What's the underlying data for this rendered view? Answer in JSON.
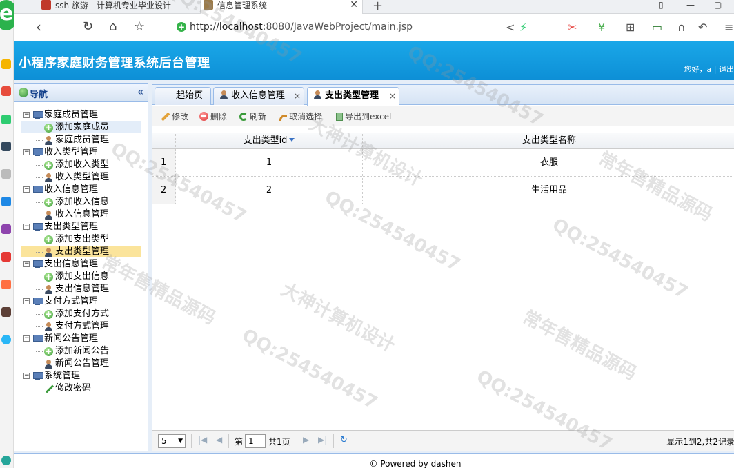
{
  "browser": {
    "tabs": [
      {
        "title": "ssh 旅游 - 计算机专业毕业设计"
      },
      {
        "title": "信息管理系统"
      }
    ],
    "url_prefix": "http://",
    "url_host": "localhost",
    "url_path": ":8080/JavaWebProject/main.jsp"
  },
  "header": {
    "title": "小程序家庭财务管理系统后台管理",
    "user_text": "您好，a | 退出"
  },
  "nav": {
    "title": "导航",
    "groups": [
      {
        "label": "家庭成员管理",
        "children": [
          {
            "label": "添加家庭成员",
            "icon": "add-icon"
          },
          {
            "label": "家庭成员管理",
            "icon": "user-icon"
          }
        ]
      },
      {
        "label": "收入类型管理",
        "children": [
          {
            "label": "添加收入类型",
            "icon": "add-icon"
          },
          {
            "label": "收入类型管理",
            "icon": "user-icon"
          }
        ]
      },
      {
        "label": "收入信息管理",
        "children": [
          {
            "label": "添加收入信息",
            "icon": "add-icon"
          },
          {
            "label": "收入信息管理",
            "icon": "user-icon"
          }
        ]
      },
      {
        "label": "支出类型管理",
        "children": [
          {
            "label": "添加支出类型",
            "icon": "add-icon"
          },
          {
            "label": "支出类型管理",
            "icon": "user-icon"
          }
        ]
      },
      {
        "label": "支出信息管理",
        "children": [
          {
            "label": "添加支出信息",
            "icon": "add-icon"
          },
          {
            "label": "支出信息管理",
            "icon": "user-icon"
          }
        ]
      },
      {
        "label": "支付方式管理",
        "children": [
          {
            "label": "添加支付方式",
            "icon": "add-icon"
          },
          {
            "label": "支付方式管理",
            "icon": "user-icon"
          }
        ]
      },
      {
        "label": "新闻公告管理",
        "children": [
          {
            "label": "添加新闻公告",
            "icon": "add-icon"
          },
          {
            "label": "新闻公告管理",
            "icon": "user-icon"
          }
        ]
      },
      {
        "label": "系统管理",
        "children": [
          {
            "label": "修改密码",
            "icon": "pencil-icon"
          }
        ]
      }
    ]
  },
  "center": {
    "tabs": [
      {
        "label": "起始页"
      },
      {
        "label": "收入信息管理",
        "close": "×"
      },
      {
        "label": "支出类型管理",
        "close": "×"
      }
    ],
    "toolbar": {
      "edit": "修改",
      "delete": "删除",
      "refresh": "刷新",
      "cancel_select": "取消选择",
      "export": "导出到excel"
    },
    "grid": {
      "columns": [
        "支出类型id",
        "支出类型名称"
      ],
      "rows": [
        {
          "rownum": "1",
          "id": "1",
          "name": "衣服"
        },
        {
          "rownum": "2",
          "id": "2",
          "name": "生活用品"
        }
      ]
    },
    "pager": {
      "page_size": "5",
      "page_label": "第",
      "page_value": "1",
      "total_pages": "共1页",
      "info": "显示1到2,共2记录"
    }
  },
  "footer": {
    "text": "© Powered by dashen"
  },
  "watermarks": {
    "qq": "QQ:254540457",
    "design": "大神计算机设计",
    "source": "常年售精品源码"
  },
  "colors": {
    "header_blue": "#1aa7e8",
    "panel_border": "#99bbe8",
    "highlight": "#fbe49b"
  }
}
